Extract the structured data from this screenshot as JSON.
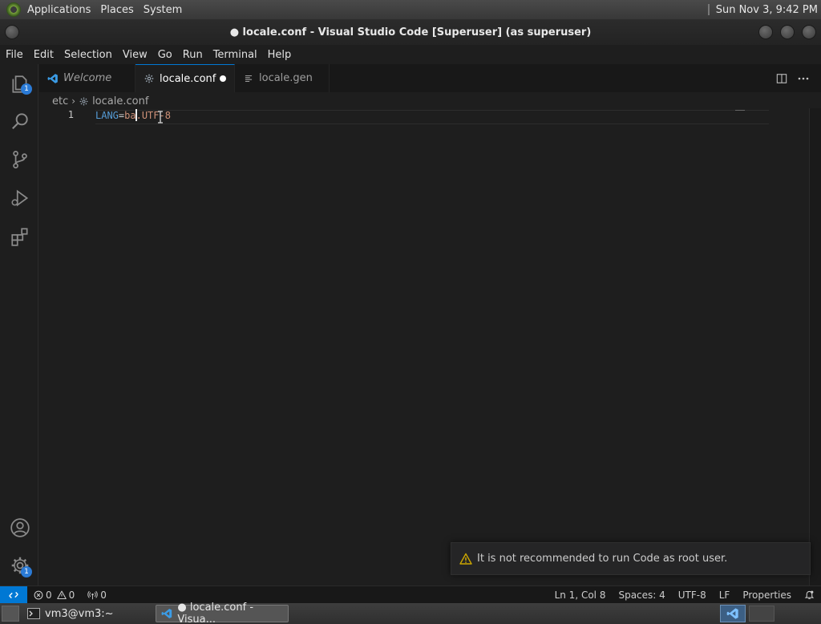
{
  "top_panel": {
    "menus": [
      "Applications",
      "Places",
      "System"
    ],
    "clock": "Sun Nov  3,  9:42 PM"
  },
  "window": {
    "title": "● locale.conf - Visual Studio Code [Superuser] (as superuser)"
  },
  "menubar": [
    "File",
    "Edit",
    "Selection",
    "View",
    "Go",
    "Run",
    "Terminal",
    "Help"
  ],
  "activity_bar": {
    "explorer_badge": "1",
    "settings_badge": "1"
  },
  "tabs": [
    {
      "label": "Welcome",
      "icon": "vscode-icon",
      "italic": true
    },
    {
      "label": "locale.conf",
      "icon": "gear-icon",
      "active": true,
      "modified": true
    },
    {
      "label": "locale.gen",
      "icon": "lines-icon"
    }
  ],
  "breadcrumb": {
    "folder": "etc",
    "file": "locale.conf"
  },
  "editor": {
    "line_number": "1",
    "key": "LANG",
    "op": "=",
    "value_before_cursor": "ba",
    "value_after_cursor": ".UTF-8"
  },
  "toast": {
    "message": "It is not recommended to run Code as root user."
  },
  "statusbar": {
    "errors": "0",
    "warnings": "0",
    "ports": "0",
    "position": "Ln 1, Col 8",
    "spaces": "Spaces: 4",
    "encoding": "UTF-8",
    "eol": "LF",
    "language": "Properties"
  },
  "taskbar": {
    "tasks": [
      "vm3@vm3:~",
      "● locale.conf - Visua..."
    ]
  },
  "colors": {
    "accent": "#0078d4",
    "editor_bg": "#1e1e1e",
    "key": "#569cd6",
    "value": "#ce9178",
    "warning": "#cca700"
  }
}
